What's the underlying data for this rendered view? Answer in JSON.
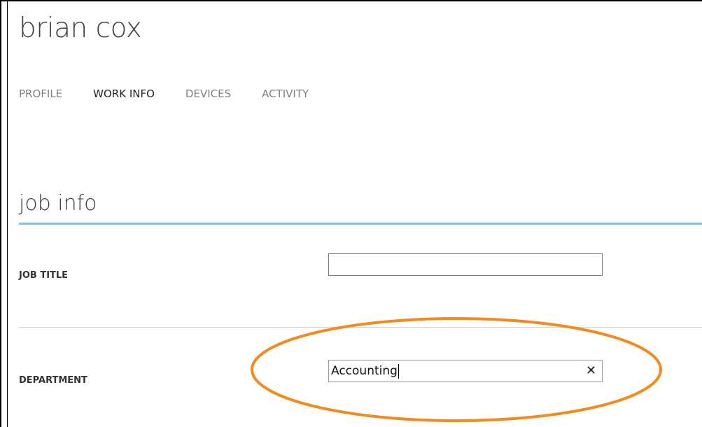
{
  "user": {
    "name": "brian cox"
  },
  "tabs": [
    {
      "label": "PROFILE",
      "active": false
    },
    {
      "label": "WORK INFO",
      "active": true
    },
    {
      "label": "DEVICES",
      "active": false
    },
    {
      "label": "ACTIVITY",
      "active": false
    }
  ],
  "section": {
    "title": "job info"
  },
  "fields": {
    "job_title": {
      "label": "JOB TITLE",
      "value": ""
    },
    "department": {
      "label": "DEPARTMENT",
      "value": "Accounting",
      "clear_icon": "close-icon"
    }
  },
  "colors": {
    "section_rule": "#8fb8de",
    "highlight_ellipse": "#f28a1c"
  }
}
